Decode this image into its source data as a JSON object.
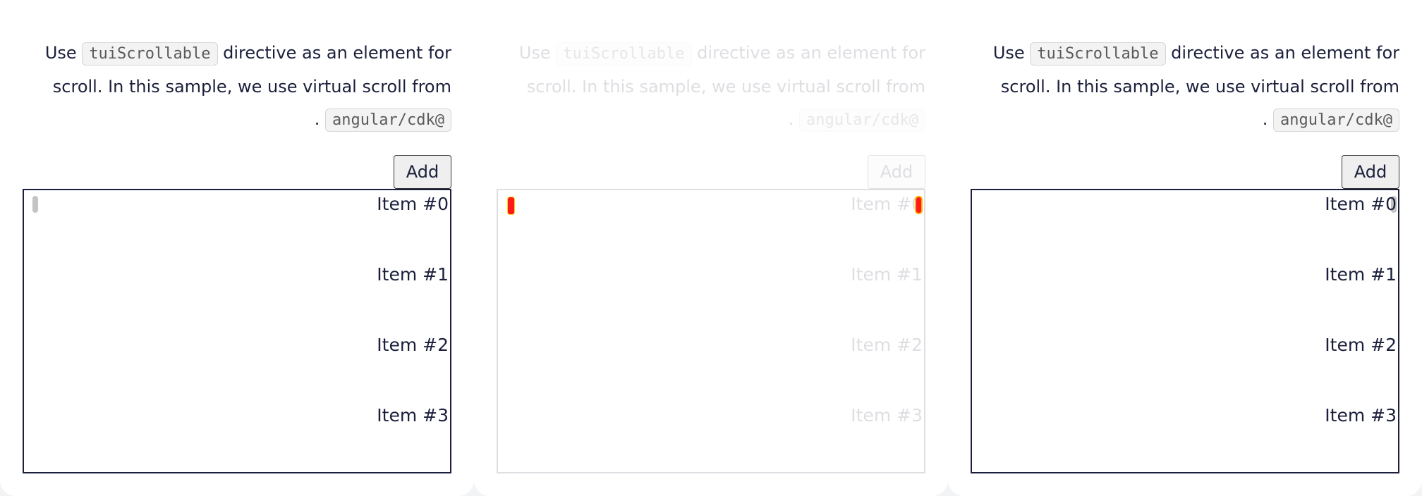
{
  "panels": [
    {
      "desc_prefix": "Use",
      "directive": "tuiScrollable",
      "desc_middle": "directive as an element for scroll. In this sample, we use virtual scroll from",
      "desc_period": ".",
      "package": "angular/cdk@",
      "add_label": "Add",
      "items": [
        "Item #0",
        "Item #1",
        "Item #2",
        "Item #3"
      ]
    },
    {
      "desc_prefix": "Use",
      "directive": "tuiScrollable",
      "desc_middle": "directive as an element for scroll. In this sample, we use virtual scroll from",
      "desc_period": ".",
      "package": "angular/cdk@",
      "add_label": "Add",
      "items": [
        "Item #0",
        "Item #1",
        "Item #2",
        "Item #3"
      ]
    },
    {
      "desc_prefix": "Use",
      "directive": "tuiScrollable",
      "desc_middle": "directive as an element for scroll. In this sample, we use virtual scroll from",
      "desc_period": ".",
      "package": "angular/cdk@",
      "add_label": "Add",
      "items": [
        "Item #0",
        "Item #1",
        "Item #2",
        "Item #3"
      ]
    }
  ],
  "colors": {
    "text": "#1b1f3b",
    "background": "#f2f3f5",
    "panel": "#ffffff",
    "highlight_marker": "#ff1a1a"
  }
}
